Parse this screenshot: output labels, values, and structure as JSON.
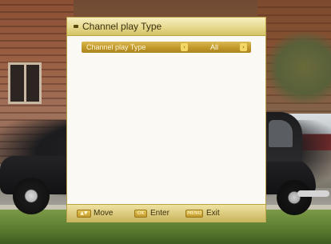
{
  "menu": {
    "title": "Channel play Type",
    "option": {
      "label": "Channel play Type",
      "value": "All",
      "left_arrow": "‹",
      "right_arrow": "›"
    }
  },
  "footer": {
    "move": {
      "key": "▲▼",
      "label": "Move"
    },
    "enter": {
      "key": "OK",
      "label": "Enter"
    },
    "exit": {
      "key": "MENU",
      "label": "Exit"
    }
  },
  "colors": {
    "panel": "#faf9f3",
    "header_gold": "#e6d98f",
    "highlight_gold": "#c49a2c",
    "text_dark": "#3c3210"
  }
}
